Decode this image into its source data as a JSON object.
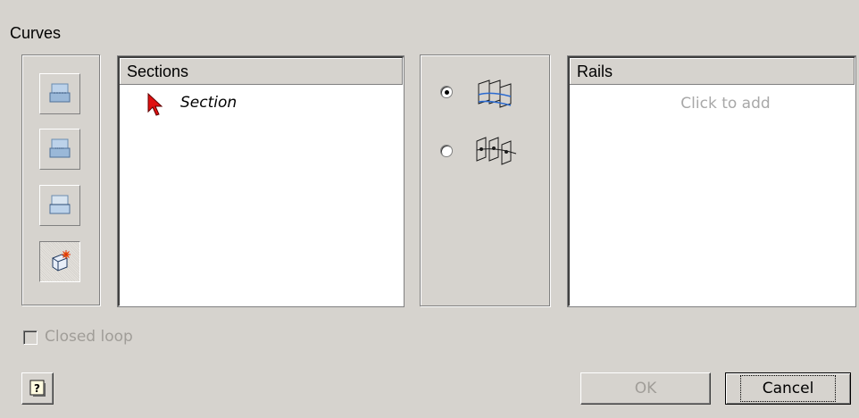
{
  "curves_label": "Curves",
  "toolbar": {
    "icons": [
      "section-sketch-icon",
      "section-edge-icon",
      "section-face-icon",
      "create-curve-icon"
    ]
  },
  "sections": {
    "header": "Sections",
    "items": [
      {
        "label": "Section"
      }
    ]
  },
  "rails": {
    "header": "Rails",
    "placeholder": "Click to add"
  },
  "mode_options": [
    {
      "icon": "rails-mode-icon",
      "selected": true
    },
    {
      "icon": "center-line-mode-icon",
      "selected": false
    }
  ],
  "closed_loop": {
    "label": "Closed loop",
    "checked": false,
    "enabled": false
  },
  "buttons": {
    "ok": "OK",
    "cancel": "Cancel"
  }
}
